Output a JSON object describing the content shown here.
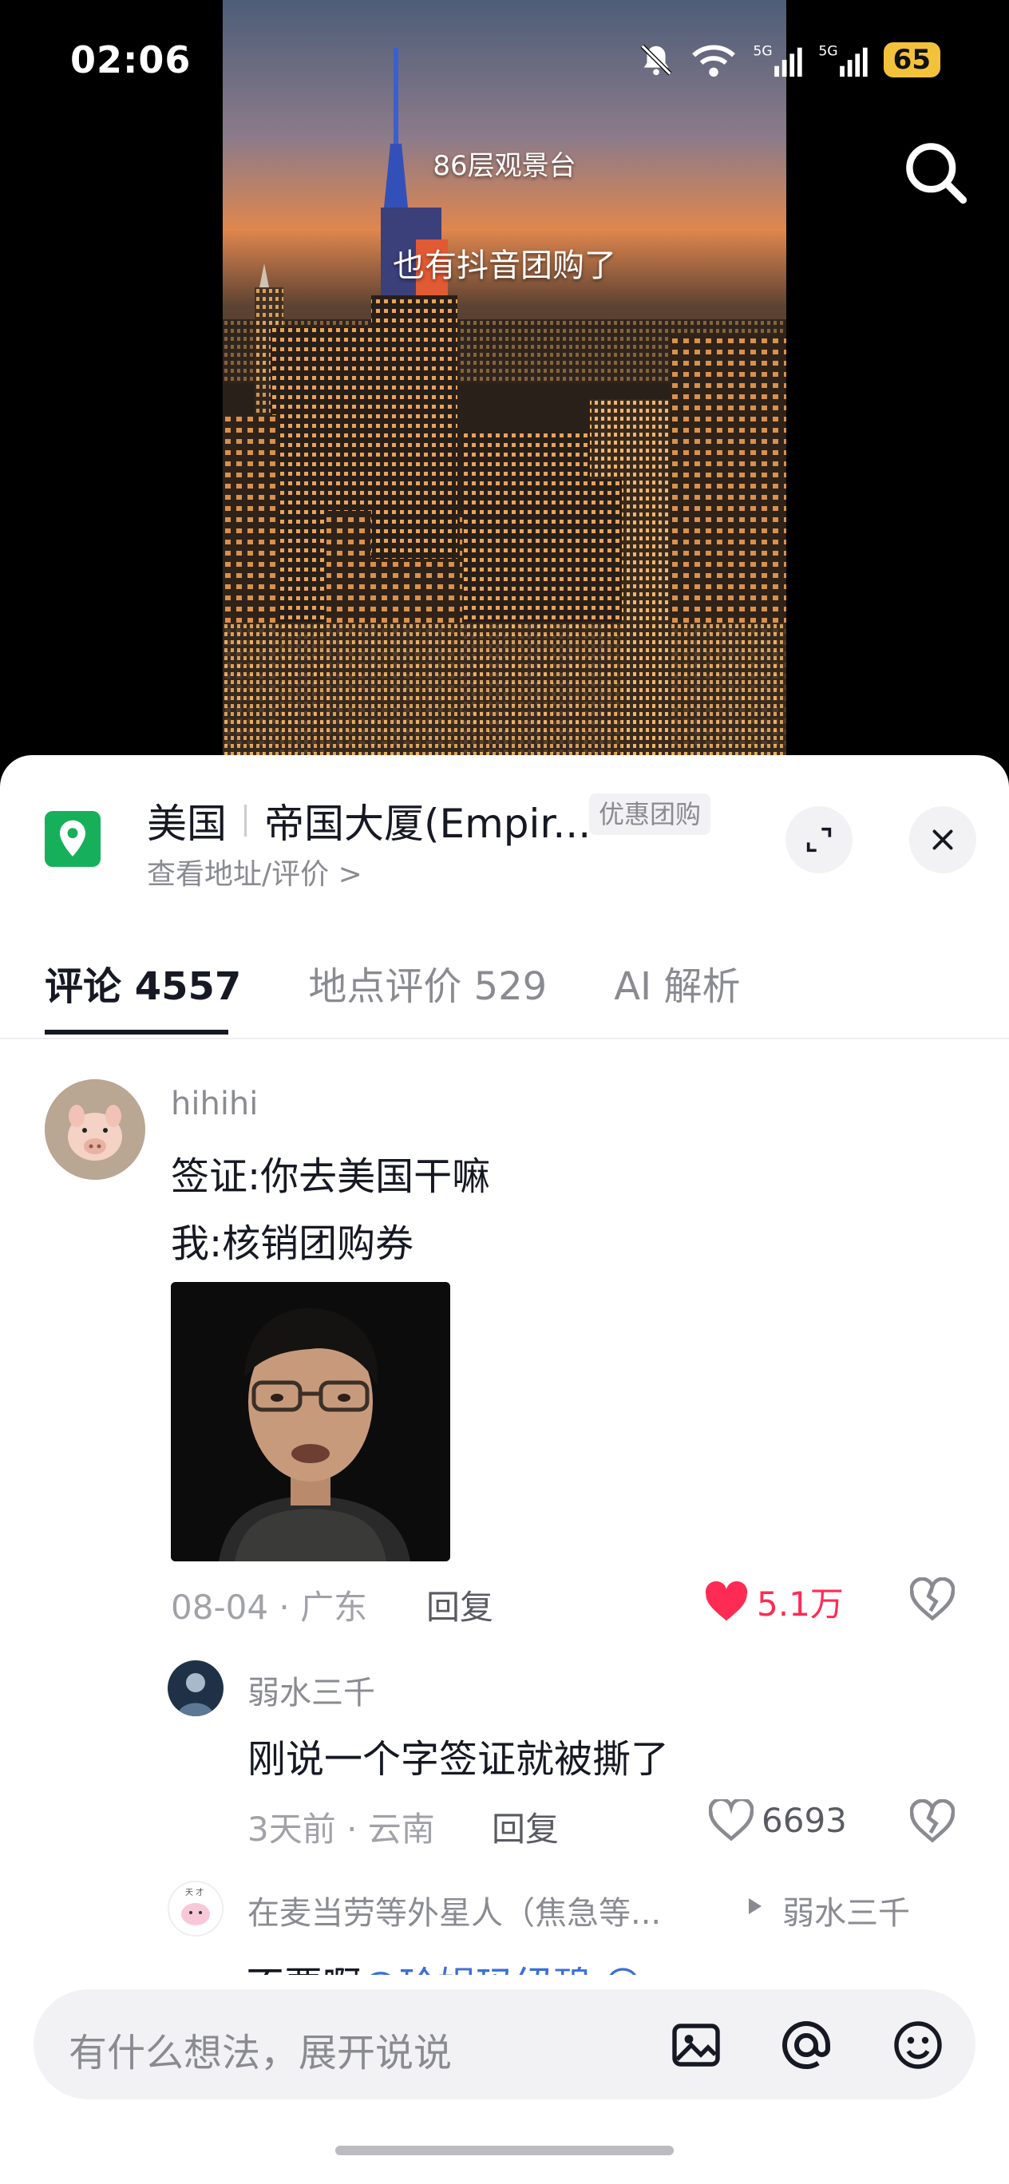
{
  "status_bar": {
    "time": "02:06",
    "battery": "65",
    "network": [
      "5G",
      "5G"
    ]
  },
  "video": {
    "caption_top": "86层观景台",
    "caption_main": "也有抖音团购了"
  },
  "location": {
    "country": "美国",
    "name": "帝国大厦(Empir...",
    "tag": "优惠团购",
    "sub": "查看地址/评价 >"
  },
  "tabs": [
    {
      "label": "评论 4557",
      "active": true
    },
    {
      "label": "地点评价 529",
      "active": false
    },
    {
      "label": "AI 解析",
      "active": false
    }
  ],
  "comments": [
    {
      "username": "hihihi",
      "lines": [
        "签证:你去美国干嘛",
        "我:核销团购券"
      ],
      "meta": "08-04 · 广东",
      "reply": "回复",
      "likes": "5.1万",
      "liked": true
    },
    {
      "username": "弱水三千",
      "lines": [
        "刚说一个字签证就被撕了"
      ],
      "meta": "3天前 · 云南",
      "reply": "回复",
      "likes": "6693",
      "liked": false
    },
    {
      "username": "在麦当劳等外星人（焦急等...",
      "reply_to": "弱水三千",
      "partial_text": "不要啊@玲娟玛纽碧 😅"
    }
  ],
  "input": {
    "placeholder": "有什么想法，展开说说"
  },
  "colors": {
    "accent_red": "#fe2c55",
    "location_green": "#17b05a",
    "mention_blue": "#3b6fd6"
  }
}
